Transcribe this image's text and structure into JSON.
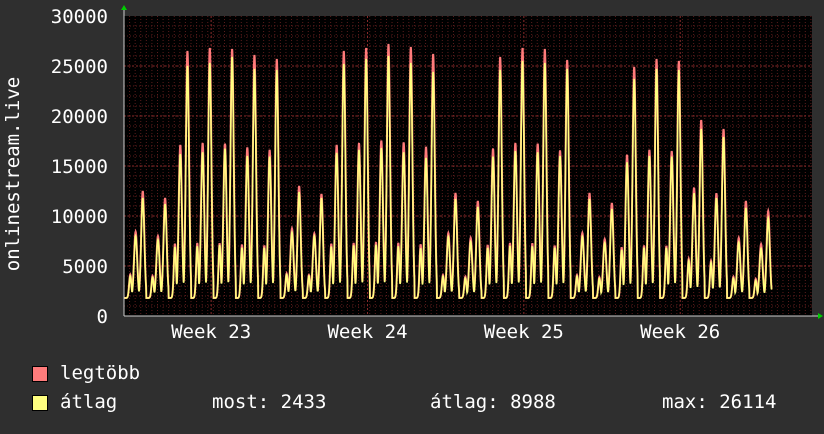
{
  "chart_data": {
    "type": "line",
    "ylabel": "onlinestream.live",
    "ylim": [
      0,
      30000
    ],
    "yticks": [
      0,
      5000,
      10000,
      15000,
      20000,
      25000,
      30000
    ],
    "ytick_labels": [
      "0",
      "5000",
      "10000",
      "15000",
      "20000",
      "25000",
      "30000"
    ],
    "xtick_labels": [
      "Week 23",
      "Week 24",
      "Week 25",
      "Week 26"
    ],
    "x_start_day": 0,
    "x_end_day": 30.8,
    "xtick_days": [
      3.9,
      10.9,
      17.9,
      24.9
    ],
    "grid": true,
    "colors": {
      "background": "#2f2f2f",
      "plot_background": "#000000",
      "grid": "#5a1c1c",
      "text": "#ffffff",
      "max_series": "#ff7b7b",
      "avg_series": "#ffff7f",
      "axis_arrow": "#00cc00"
    },
    "daily_peaks": {
      "max": [
        12500,
        11800,
        26500,
        26800,
        26700,
        26100,
        25700,
        13000,
        12200,
        26500,
        26800,
        27200,
        26900,
        26200,
        12300,
        11500,
        25900,
        26800,
        26700,
        25600,
        12300,
        11300,
        24900,
        25700,
        25500,
        19600,
        18700,
        11500,
        10500
      ],
      "avg": [
        11800,
        11200,
        25000,
        25300,
        25900,
        24700,
        24600,
        12400,
        11800,
        25200,
        25700,
        26000,
        25300,
        24400,
        11700,
        10900,
        24600,
        25500,
        25300,
        24700,
        11700,
        10700,
        23700,
        24700,
        24600,
        18700,
        17900,
        10800,
        9800
      ]
    },
    "daily_trough": 1800,
    "series": [
      {
        "name": "legtöbb",
        "color": "#ff7b7b"
      },
      {
        "name": "átlag",
        "color": "#ffff7f"
      }
    ],
    "stats": {
      "now": "most: 2433",
      "avg": "átlag: 8988",
      "max": "max: 26114"
    }
  }
}
